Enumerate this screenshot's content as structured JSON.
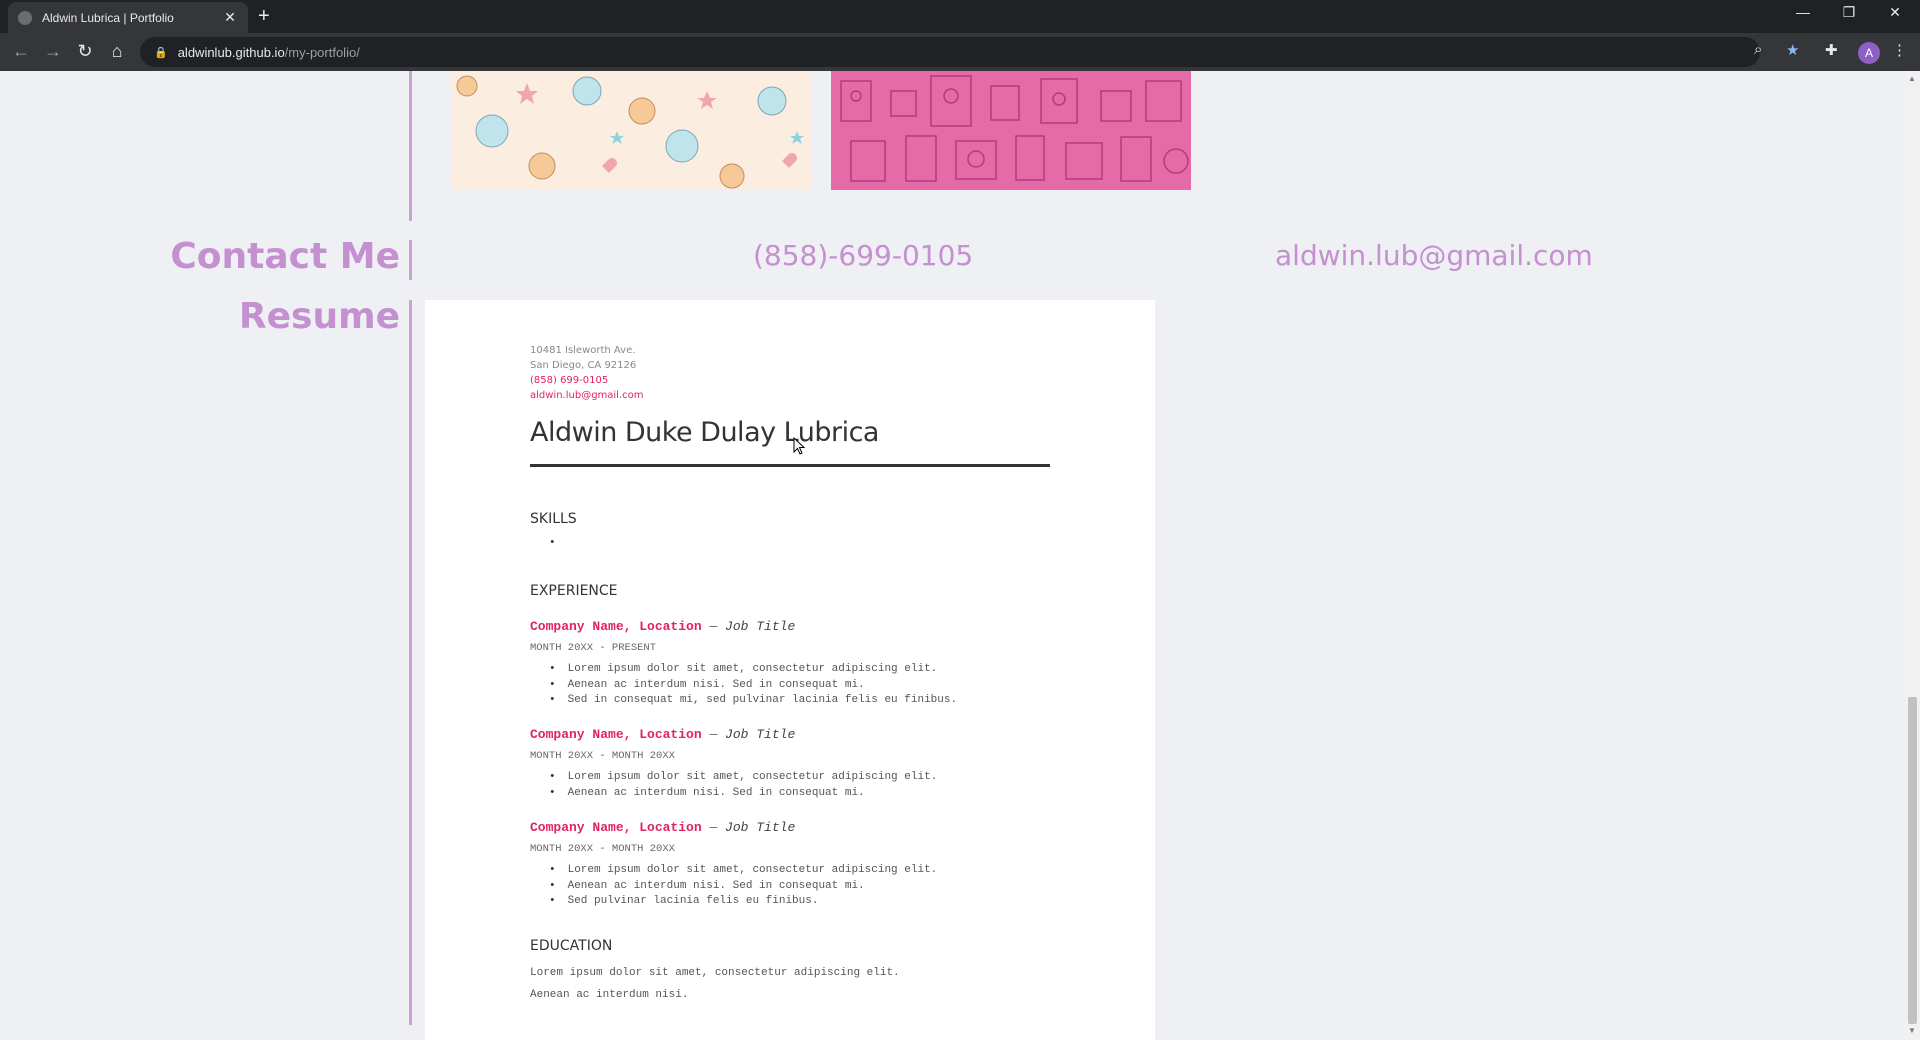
{
  "browser": {
    "tab_title": "Aldwin Lubrica | Portfolio",
    "tab_close": "✕",
    "new_tab": "+",
    "url_host": "aldwinlub.github.io",
    "url_path": "/my-portfolio/",
    "profile_initial": "A",
    "window_controls": {
      "minimize": "—",
      "restore": "❐",
      "close": "✕"
    },
    "nav": {
      "back": "←",
      "forward": "→",
      "reload": "↻",
      "home": "⌂"
    }
  },
  "contact": {
    "label": "Contact Me",
    "phone": "(858)-699-0105",
    "email": "aldwin.lub@gmail.com"
  },
  "resume_section": {
    "label": "Resume",
    "address_line1": "10481 Isleworth Ave.",
    "address_line2": "San Diego, CA 92126",
    "phone": "(858) 699-0105",
    "email": "aldwin.lub@gmail.com",
    "name": "Aldwin Duke Dulay Lubrica",
    "skills_heading": "SKILLS",
    "experience_heading": "EXPERIENCE",
    "jobs": [
      {
        "company": "Company Name, Location",
        "separator": " — ",
        "title": "Job Title",
        "dates": "MONTH 20XX - PRESENT",
        "bullets": [
          "Lorem ipsum dolor sit amet, consectetur adipiscing elit.",
          "Aenean ac interdum nisi. Sed in consequat mi.",
          "Sed in consequat mi, sed pulvinar lacinia felis eu finibus."
        ]
      },
      {
        "company": "Company Name, Location",
        "separator": " — ",
        "title": "Job Title",
        "dates": "MONTH 20XX - MONTH 20XX",
        "bullets": [
          "Lorem ipsum dolor sit amet, consectetur adipiscing elit.",
          "Aenean ac interdum nisi. Sed in consequat mi."
        ]
      },
      {
        "company": "Company Name, Location",
        "separator": " — ",
        "title": "Job Title",
        "dates": "MONTH 20XX - MONTH 20XX",
        "bullets": [
          "Lorem ipsum dolor sit amet, consectetur adipiscing elit.",
          "Aenean ac interdum nisi. Sed in consequat mi.",
          "Sed pulvinar lacinia felis eu finibus."
        ]
      }
    ],
    "education_heading": "EDUCATION",
    "education_line1": "Lorem ipsum dolor sit amet, consectetur adipiscing elit.",
    "education_line2": "Aenean ac interdum nisi."
  },
  "colors": {
    "accent_purple": "#c490cf",
    "resume_pink": "#e0245e"
  }
}
